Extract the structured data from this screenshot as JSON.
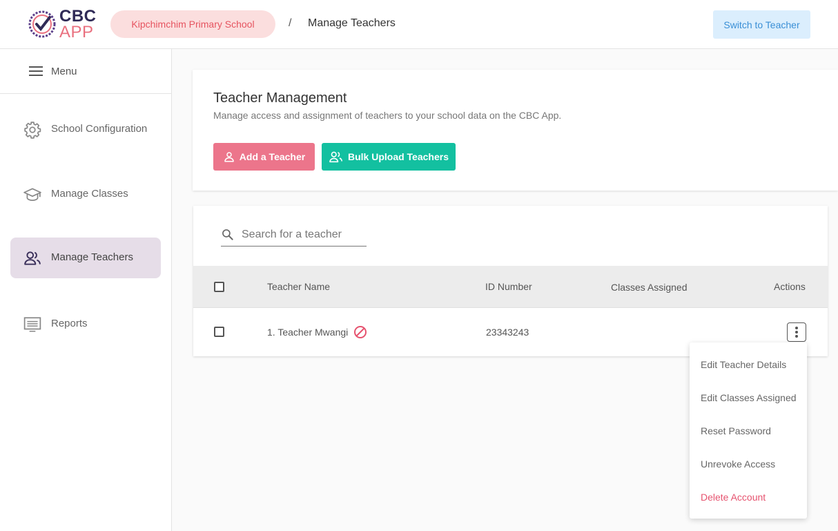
{
  "brand": {
    "line1": "CBC",
    "line2": "APP",
    "accent": "#e9707f",
    "primary": "#2f2a56"
  },
  "header": {
    "school": "Kipchimchim Primary School",
    "separator": "/",
    "page": "Manage Teachers",
    "switch_label": "Switch to Teacher"
  },
  "sidebar": {
    "menu_label": "Menu",
    "items": [
      {
        "label": "School Configuration",
        "icon": "gear-icon"
      },
      {
        "label": "Manage Classes",
        "icon": "graduation-cap-icon"
      },
      {
        "label": "Manage Teachers",
        "icon": "users-icon",
        "active": true
      },
      {
        "label": "Reports",
        "icon": "monitor-icon"
      }
    ]
  },
  "main": {
    "title": "Teacher Management",
    "subtitle": "Manage access and assignment of teachers to your school data on the CBC App.",
    "add_label": "Add a Teacher",
    "bulk_label": "Bulk Upload Teachers",
    "search_placeholder": "Search for a teacher",
    "columns": [
      "Teacher Name",
      "ID Number",
      "Classes Assigned",
      "Actions"
    ],
    "rows": [
      {
        "name": "1. Teacher Mwangi",
        "id": "23343243",
        "classes": "",
        "revoked": true
      }
    ],
    "actions_menu": [
      "Edit Teacher Details",
      "Edit Classes Assigned",
      "Reset Password",
      "Unrevoke Access",
      "Delete Account"
    ]
  },
  "colors": {
    "add_button": "#ec758b",
    "bulk_button": "#13c0a0",
    "active_nav": "#e6dde8",
    "danger": "#e6536f"
  }
}
